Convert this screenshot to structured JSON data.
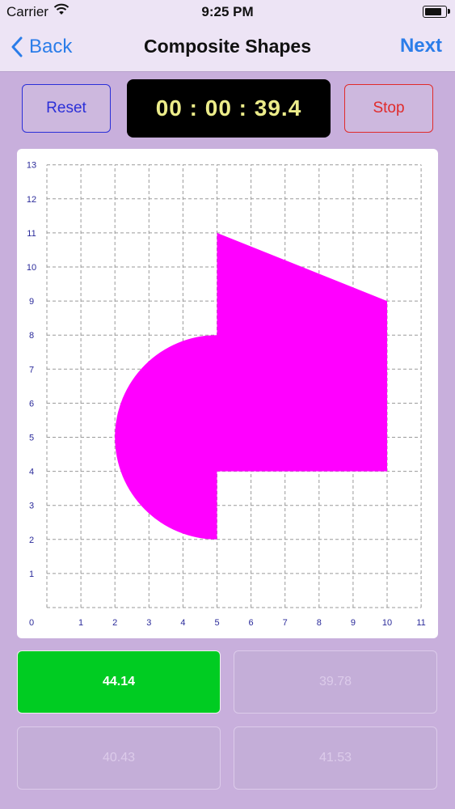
{
  "status_bar": {
    "carrier": "Carrier",
    "time": "9:25 PM",
    "battery_level": 0.9
  },
  "nav": {
    "back_label": "Back",
    "title": "Composite Shapes",
    "next_label": "Next"
  },
  "controls": {
    "reset_label": "Reset",
    "timer": "00 : 00 : 39.4",
    "stop_label": "Stop"
  },
  "grid": {
    "x_ticks": [
      "0",
      "1",
      "2",
      "3",
      "4",
      "5",
      "6",
      "7",
      "8",
      "9",
      "10",
      "11"
    ],
    "y_ticks": [
      "1",
      "2",
      "3",
      "4",
      "5",
      "6",
      "7",
      "8",
      "9",
      "10",
      "11",
      "12",
      "13"
    ],
    "x_range": [
      0,
      11
    ],
    "y_range": [
      0,
      13
    ],
    "shape_color": "#ff00ff",
    "shape": {
      "semicircle": {
        "center": [
          5,
          5
        ],
        "radius": 3,
        "side": "left"
      },
      "polygon": [
        [
          5,
          4
        ],
        [
          5,
          11
        ],
        [
          10,
          9
        ],
        [
          10,
          4
        ]
      ]
    }
  },
  "answers": [
    {
      "label": "44.14",
      "selected": true
    },
    {
      "label": "39.78",
      "selected": false
    },
    {
      "label": "40.43",
      "selected": false
    },
    {
      "label": "41.53",
      "selected": false
    }
  ],
  "colors": {
    "accent": "#2b7de9",
    "selected": "#00cc22",
    "reset": "#2b2fd8",
    "stop": "#e02b2b"
  }
}
